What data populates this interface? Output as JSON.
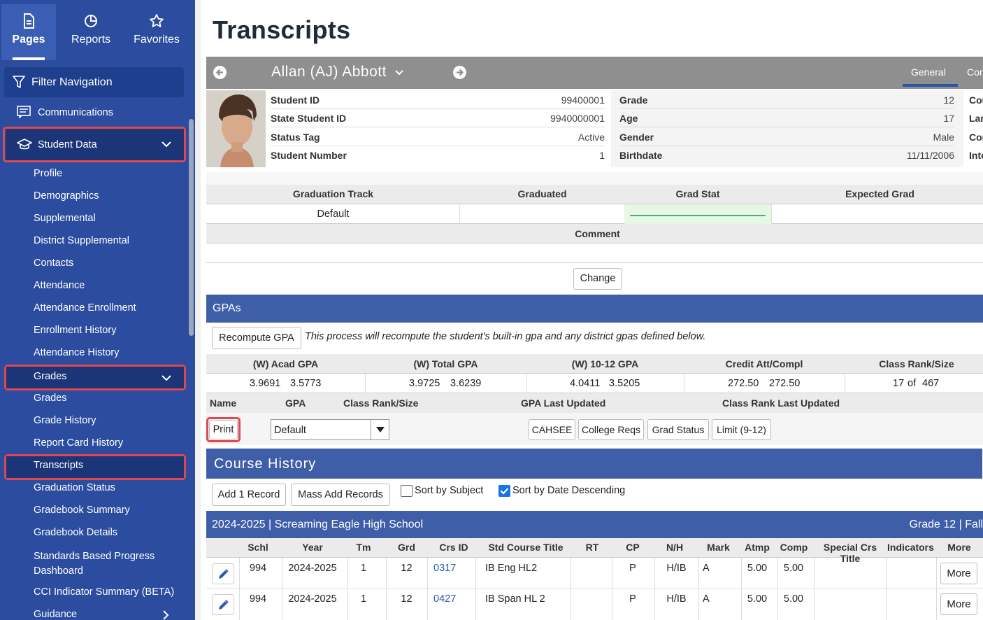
{
  "sidebar": {
    "tabs": [
      {
        "label": "Pages",
        "icon": "document-icon"
      },
      {
        "label": "Reports",
        "icon": "pie-chart-icon"
      },
      {
        "label": "Favorites",
        "icon": "star-icon"
      }
    ],
    "filter_label": "Filter Navigation",
    "communications": "Communications",
    "student_data": "Student Data",
    "student_items": [
      "Profile",
      "Demographics",
      "Supplemental",
      "District Supplemental",
      "Contacts",
      "Attendance",
      "Attendance Enrollment",
      "Enrollment History",
      "Attendance History"
    ],
    "grades_group": "Grades",
    "grades_items": [
      "Grades",
      "Grade History",
      "Report Card History",
      "Transcripts",
      "Graduation Status",
      "Gradebook Summary",
      "Gradebook Details"
    ],
    "standards_line1": "Standards Based Progress",
    "standards_line2": "Dashboard",
    "cci": "CCI Indicator Summary (BETA)",
    "guidance": "Guidance"
  },
  "page": {
    "title": "Transcripts",
    "student_name": "Allan (AJ) Abbott",
    "tab_general": "General",
    "tab_contacts": "Cont"
  },
  "student_info": {
    "left": [
      {
        "label": "Student ID",
        "value": "99400001"
      },
      {
        "label": "State Student ID",
        "value": "9940000001"
      },
      {
        "label": "Status Tag",
        "value": "Active"
      },
      {
        "label": "Student Number",
        "value": "1"
      }
    ],
    "right": [
      {
        "label": "Grade",
        "value": "12"
      },
      {
        "label": "Age",
        "value": "17"
      },
      {
        "label": "Gender",
        "value": "Male"
      },
      {
        "label": "Birthdate",
        "value": "11/11/2006"
      }
    ],
    "far_right": [
      "Cou",
      "Lan",
      "Cor",
      "Inte"
    ]
  },
  "graduation": {
    "headers": [
      "Graduation Track",
      "Graduated",
      "Grad Stat",
      "Expected Grad"
    ],
    "track_value": "Default",
    "comment_header": "Comment",
    "change_button": "Change"
  },
  "gpas": {
    "section_title": "GPAs",
    "recompute_button": "Recompute GPA",
    "recompute_note": "This process will recompute the student's built-in gpa and any district gpas defined below.",
    "headers": [
      "(W) Acad GPA",
      "(W) Total GPA",
      "(W) 10-12 GPA",
      "Credit Att/Compl",
      "Class Rank/Size"
    ],
    "values": [
      [
        "3.9691",
        "3.5773"
      ],
      [
        "3.9725",
        "3.6239"
      ],
      [
        "4.0411",
        "3.5205"
      ],
      [
        "272.50",
        "272.50"
      ],
      [
        "17",
        "of",
        "467"
      ]
    ],
    "sub_headers": [
      "Name",
      "GPA",
      "Class Rank/Size",
      "GPA Last Updated",
      "Class Rank Last Updated"
    ],
    "print_button": "Print",
    "select_value": "Default",
    "buttons": [
      "CAHSEE",
      "College Reqs",
      "Grad Status",
      "Limit (9-12)"
    ]
  },
  "course_history": {
    "section_title": "Course History",
    "add_button": "Add 1 Record",
    "mass_add_button": "Mass Add Records",
    "sort_subject": "Sort by Subject",
    "sort_date": "Sort by Date Descending",
    "term_title": "2024-2025 | Screaming Eagle High School",
    "term_grade": "Grade 12 | Fall",
    "columns": [
      "Schl",
      "Year",
      "Tm",
      "Grd",
      "Crs ID",
      "Std Course Title",
      "RT",
      "CP",
      "N/H",
      "Mark",
      "Atmp",
      "Comp",
      "Special Crs Title",
      "Indicators",
      "More"
    ],
    "rows": [
      {
        "schl": "994",
        "year": "2024-2025",
        "tm": "1",
        "grd": "12",
        "crs_id": "0317",
        "title": "IB Eng HL2",
        "rt": "",
        "cp": "P",
        "nh": "H/IB",
        "mark": "A",
        "atmp": "5.00",
        "comp": "5.00",
        "more": "More"
      },
      {
        "schl": "994",
        "year": "2024-2025",
        "tm": "1",
        "grd": "12",
        "crs_id": "0427",
        "title": "IB Span HL 2",
        "rt": "",
        "cp": "P",
        "nh": "H/IB",
        "mark": "A",
        "atmp": "5.00",
        "comp": "5.00",
        "more": "More"
      }
    ]
  },
  "colors": {
    "sidebar": "#2b4c9f",
    "highlight": "#e0484f",
    "section_bar": "#3f5ea8",
    "link": "#2e5bb0"
  }
}
